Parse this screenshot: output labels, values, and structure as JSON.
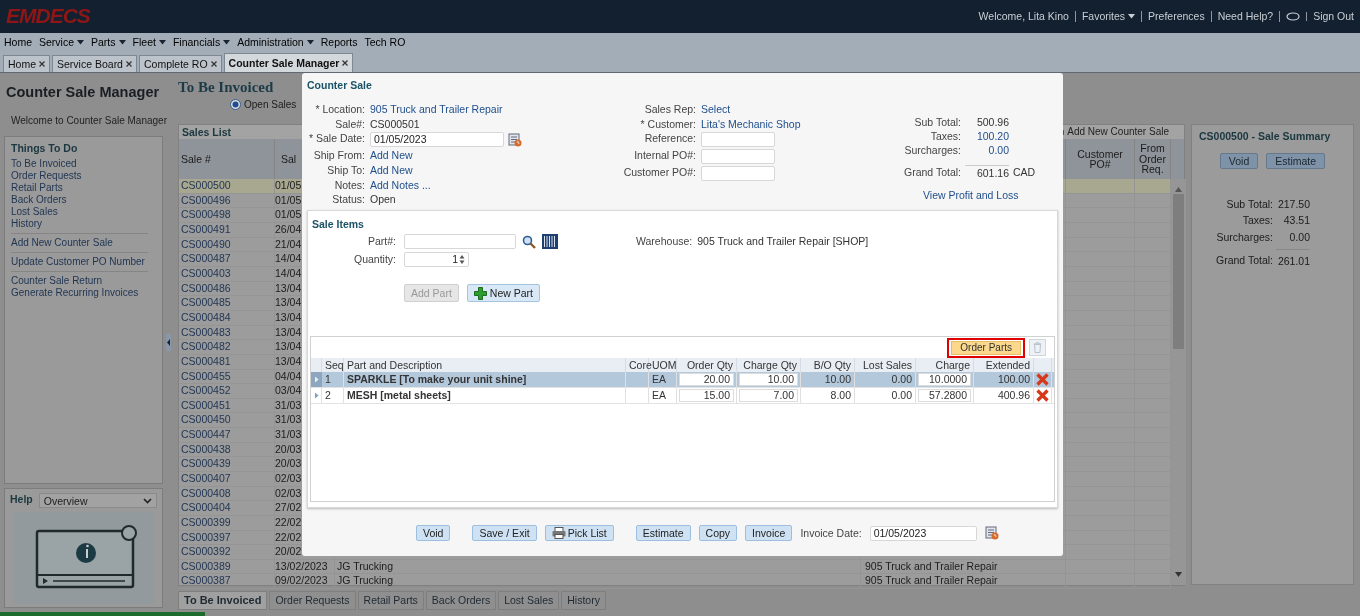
{
  "header": {
    "logo": "EMDECS",
    "links": [
      {
        "kind": "text",
        "label": "Welcome, Lita Kino"
      },
      {
        "kind": "menu",
        "label": "Favorites"
      },
      {
        "kind": "link",
        "label": "Preferences"
      },
      {
        "kind": "link",
        "label": "Need Help?"
      },
      {
        "kind": "chat"
      },
      {
        "kind": "link",
        "label": "Sign Out"
      }
    ]
  },
  "menu": [
    {
      "label": "Home",
      "dropdown": false
    },
    {
      "label": "Service",
      "dropdown": true
    },
    {
      "label": "Parts",
      "dropdown": true
    },
    {
      "label": "Fleet",
      "dropdown": true
    },
    {
      "label": "Financials",
      "dropdown": true
    },
    {
      "label": "Administration",
      "dropdown": true
    },
    {
      "label": "Reports",
      "dropdown": false
    },
    {
      "label": "Tech RO",
      "dropdown": false
    }
  ],
  "tabs": [
    {
      "label": "Home",
      "selected": false
    },
    {
      "label": "Service Board",
      "selected": false
    },
    {
      "label": "Complete RO",
      "selected": false
    },
    {
      "label": "Counter Sale Manager",
      "selected": true
    }
  ],
  "left_panel": {
    "title": "Counter Sale Manager",
    "welcome": "Welcome to Counter Sale Manager",
    "todo": {
      "title": "Things To Do",
      "groups": [
        [
          "To Be Invoiced",
          "Order Requests",
          "Retail Parts",
          "Back Orders",
          "Lost Sales",
          "History"
        ],
        [
          "Add New Counter Sale"
        ],
        [
          "Update Customer PO Number"
        ],
        [
          "Counter Sale Return",
          "Generate Recurring Invoices"
        ]
      ]
    },
    "help": {
      "title": "Help",
      "topic": "Overview"
    }
  },
  "main": {
    "title": "To Be Invoiced",
    "filter": {
      "label": "Open Sales",
      "selected": true
    },
    "list": {
      "title": "Sales List",
      "add_label": "Add New Counter Sale",
      "columns": [
        "Sale #",
        "Sal",
        "Customer PO#",
        "From Order Req."
      ],
      "rows": [
        {
          "sale": "CS000500",
          "date": "01/05",
          "selected": true
        },
        {
          "sale": "CS000496",
          "date": "01/05",
          "selected": false
        },
        {
          "sale": "CS000498",
          "date": "01/05",
          "selected": false
        },
        {
          "sale": "CS000491",
          "date": "26/04",
          "selected": false
        },
        {
          "sale": "CS000490",
          "date": "21/04",
          "selected": false
        },
        {
          "sale": "CS000487",
          "date": "14/04",
          "selected": false
        },
        {
          "sale": "CS000403",
          "date": "14/04",
          "selected": false
        },
        {
          "sale": "CS000486",
          "date": "13/04",
          "selected": false
        },
        {
          "sale": "CS000485",
          "date": "13/04",
          "selected": false
        },
        {
          "sale": "CS000484",
          "date": "13/04",
          "selected": false
        },
        {
          "sale": "CS000483",
          "date": "13/04",
          "selected": false
        },
        {
          "sale": "CS000482",
          "date": "13/04",
          "selected": false
        },
        {
          "sale": "CS000481",
          "date": "13/04",
          "selected": false
        },
        {
          "sale": "CS000455",
          "date": "04/04",
          "selected": false
        },
        {
          "sale": "CS000452",
          "date": "03/04",
          "selected": false
        },
        {
          "sale": "CS000451",
          "date": "31/03",
          "selected": false
        },
        {
          "sale": "CS000450",
          "date": "31/03",
          "selected": false
        },
        {
          "sale": "CS000447",
          "date": "31/03",
          "selected": false
        },
        {
          "sale": "CS000438",
          "date": "20/03",
          "selected": false
        },
        {
          "sale": "CS000439",
          "date": "20/03",
          "selected": false
        },
        {
          "sale": "CS000407",
          "date": "02/03",
          "selected": false
        },
        {
          "sale": "CS000408",
          "date": "02/03",
          "selected": false
        },
        {
          "sale": "CS000404",
          "date": "27/02",
          "selected": false
        },
        {
          "sale": "CS000399",
          "date": "22/02",
          "selected": false
        },
        {
          "sale": "CS000397",
          "date": "22/02",
          "selected": false
        },
        {
          "sale": "CS000392",
          "date": "20/02",
          "selected": false
        },
        {
          "sale": "CS000389",
          "date": "13/02/2023",
          "customer": "JG Trucking",
          "location": "905 Truck and Trailer Repair",
          "selected": false
        },
        {
          "sale": "CS000387",
          "date": "09/02/2023",
          "customer": "JG Trucking",
          "location": "905 Truck and Trailer Repair",
          "selected": false
        }
      ]
    }
  },
  "summary": {
    "title": "CS000500 - Sale Summary",
    "buttons": [
      "Void",
      "Estimate"
    ],
    "totals": [
      {
        "label": "Sub Total:",
        "value": "217.50",
        "grand": false
      },
      {
        "label": "Taxes:",
        "value": "43.51",
        "grand": false
      },
      {
        "label": "Surcharges:",
        "value": "0.00",
        "grand": false
      },
      {
        "label": "Grand Total:",
        "value": "261.01",
        "grand": true
      }
    ]
  },
  "bottom_tabs": [
    {
      "label": "To Be Invoiced",
      "selected": true
    },
    {
      "label": "Order Requests",
      "selected": false
    },
    {
      "label": "Retail Parts",
      "selected": false
    },
    {
      "label": "Back Orders",
      "selected": false
    },
    {
      "label": "Lost Sales",
      "selected": false
    },
    {
      "label": "History",
      "selected": false
    }
  ],
  "modal": {
    "title": "Counter Sale",
    "left_fields": [
      {
        "label": "* Location:",
        "kind": "link",
        "value": "905 Truck and Trailer Repair"
      },
      {
        "label": "Sale#:",
        "kind": "text",
        "value": "CS000501"
      },
      {
        "label": "* Sale Date:",
        "kind": "date",
        "value": "01/05/2023"
      },
      {
        "label": "Ship From:",
        "kind": "link",
        "value": "Add New"
      },
      {
        "label": "Ship To:",
        "kind": "link",
        "value": "Add New"
      },
      {
        "label": "Notes:",
        "kind": "link",
        "value": "Add Notes ..."
      },
      {
        "label": "Status:",
        "kind": "text",
        "value": "Open"
      }
    ],
    "middle_fields": [
      {
        "label": "Sales Rep:",
        "kind": "link",
        "value": "Select"
      },
      {
        "label": "* Customer:",
        "kind": "link",
        "value": "Lita's Mechanic Shop"
      },
      {
        "label": "Reference:",
        "kind": "input"
      },
      {
        "label": "Internal PO#:",
        "kind": "input"
      },
      {
        "label": "Customer PO#:",
        "kind": "input"
      }
    ],
    "totals": [
      {
        "label": "Sub Total:",
        "value": "500.96",
        "kind": "text"
      },
      {
        "label": "Taxes:",
        "value": "100.20",
        "kind": "link"
      },
      {
        "label": "Surcharges:",
        "value": "0.00",
        "kind": "link"
      },
      {
        "label": "Grand Total:",
        "value": "601.16",
        "currency": "CAD",
        "kind": "grand"
      }
    ],
    "profit_link": "View Profit and Loss",
    "items": {
      "title": "Sale Items",
      "part_label": "Part#:",
      "qty_label": "Quantity:",
      "qty": "1",
      "warehouse_label": "Warehouse:",
      "warehouse": "905 Truck and Trailer Repair [SHOP]",
      "add_button": {
        "label": "Add Part",
        "disabled": true
      },
      "new_button": "New Part"
    },
    "grid": {
      "order_button": {
        "label": "Order Parts",
        "highlighted": true
      },
      "delete_disabled": true,
      "columns": [
        "Seq",
        "Part and Description",
        "Core",
        "UOM",
        "Order Qty",
        "Charge Qty",
        "B/O Qty",
        "Lost Sales",
        "Charge",
        "Extended"
      ],
      "rows": [
        {
          "seq": "1",
          "part": "SPARKLE [To make your unit shine]",
          "uom": "EA",
          "order_qty": "20.00",
          "charge_qty": "10.00",
          "bo_qty": "10.00",
          "lost": "0.00",
          "charge": "10.0000",
          "extended": "100.00",
          "selected": true
        },
        {
          "seq": "2",
          "part": "MESH [metal sheets]",
          "uom": "EA",
          "order_qty": "15.00",
          "charge_qty": "7.00",
          "bo_qty": "8.00",
          "lost": "0.00",
          "charge": "57.2800",
          "extended": "400.96",
          "selected": false
        }
      ]
    },
    "buttons": [
      {
        "label": "Void",
        "kind": "plain"
      },
      {
        "label": "Save / Exit",
        "kind": "plain"
      },
      {
        "label": "Pick List",
        "kind": "print"
      },
      {
        "label": "Estimate",
        "kind": "plain"
      },
      {
        "label": "Copy",
        "kind": "plain"
      },
      {
        "label": "Invoice",
        "kind": "plain"
      }
    ],
    "invoice_date": {
      "label": "Invoice Date:",
      "value": "01/05/2023"
    }
  }
}
